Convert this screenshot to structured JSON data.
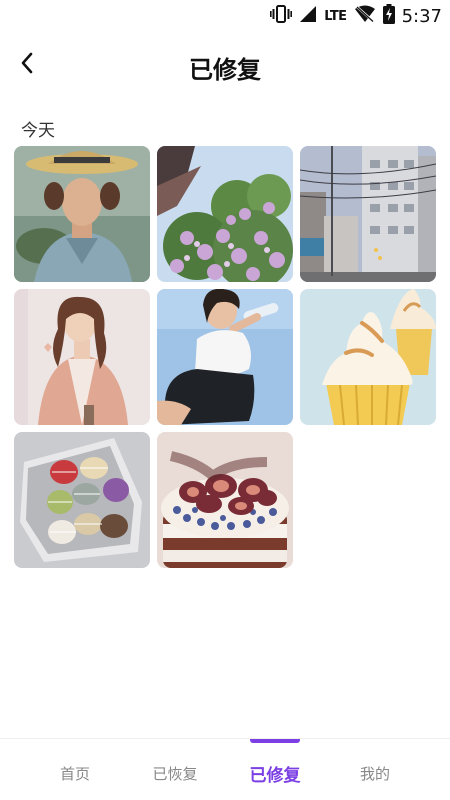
{
  "status_bar": {
    "time": "5:37",
    "network": "LTE"
  },
  "header": {
    "title": "已修复",
    "back_icon": "chevron-left-icon"
  },
  "section": {
    "label": "今天"
  },
  "photos": [
    {
      "subject": "woman-straw-hat-portrait"
    },
    {
      "subject": "pink-flowers-pagoda"
    },
    {
      "subject": "street-buildings-power-lines"
    },
    {
      "subject": "woman-pink-coat"
    },
    {
      "subject": "girl-drinking-sky"
    },
    {
      "subject": "meringue-cupcakes"
    },
    {
      "subject": "macarons-box"
    },
    {
      "subject": "fig-layer-cake"
    }
  ],
  "nav": {
    "items": [
      {
        "label": "首页"
      },
      {
        "label": "已恢复"
      },
      {
        "label": "已修复"
      },
      {
        "label": "我的"
      }
    ],
    "active_index": 2
  },
  "colors": {
    "accent": "#7b3fe4",
    "inactive": "#888888"
  }
}
